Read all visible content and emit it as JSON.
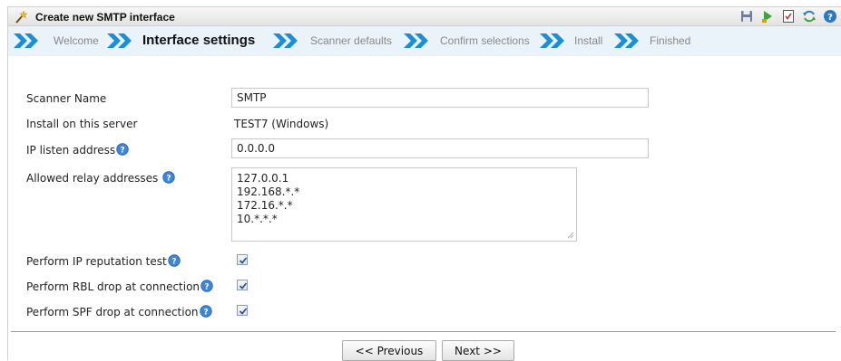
{
  "window": {
    "title": "Create new SMTP interface",
    "toolbar_icons": [
      "save-icon",
      "run-icon",
      "checklist-icon",
      "refresh-icon",
      "help-icon"
    ]
  },
  "wizard": {
    "steps": [
      {
        "label": "Welcome",
        "active": false
      },
      {
        "label": "Interface settings",
        "active": true
      },
      {
        "label": "Scanner defaults",
        "active": false
      },
      {
        "label": "Confirm selections",
        "active": false
      },
      {
        "label": "Install",
        "active": false
      },
      {
        "label": "Finished",
        "active": false
      }
    ]
  },
  "form": {
    "scanner_name": {
      "label": "Scanner Name",
      "value": "SMTP"
    },
    "install_server": {
      "label": "Install on this server",
      "value": "TEST7 (Windows)"
    },
    "ip_listen": {
      "label": "IP listen address",
      "value": "0.0.0.0"
    },
    "relay": {
      "label": "Allowed relay addresses",
      "lines": [
        "127.0.0.1",
        "192.168.*.*",
        "172.16.*.*",
        "10.*.*.*"
      ]
    },
    "ip_reputation": {
      "label": "Perform IP reputation test",
      "checked": true
    },
    "rbl_drop": {
      "label": "Perform RBL drop at connection",
      "checked": true
    },
    "spf_drop": {
      "label": "Perform SPF drop at connection",
      "checked": true
    }
  },
  "buttons": {
    "previous": "<< Previous",
    "next": "Next >>"
  },
  "colors": {
    "step_arrow": "#1a8fd8",
    "steps_bar": "#eaf2fa",
    "active_step_text": "#111111",
    "inactive_step_text": "#888888"
  }
}
